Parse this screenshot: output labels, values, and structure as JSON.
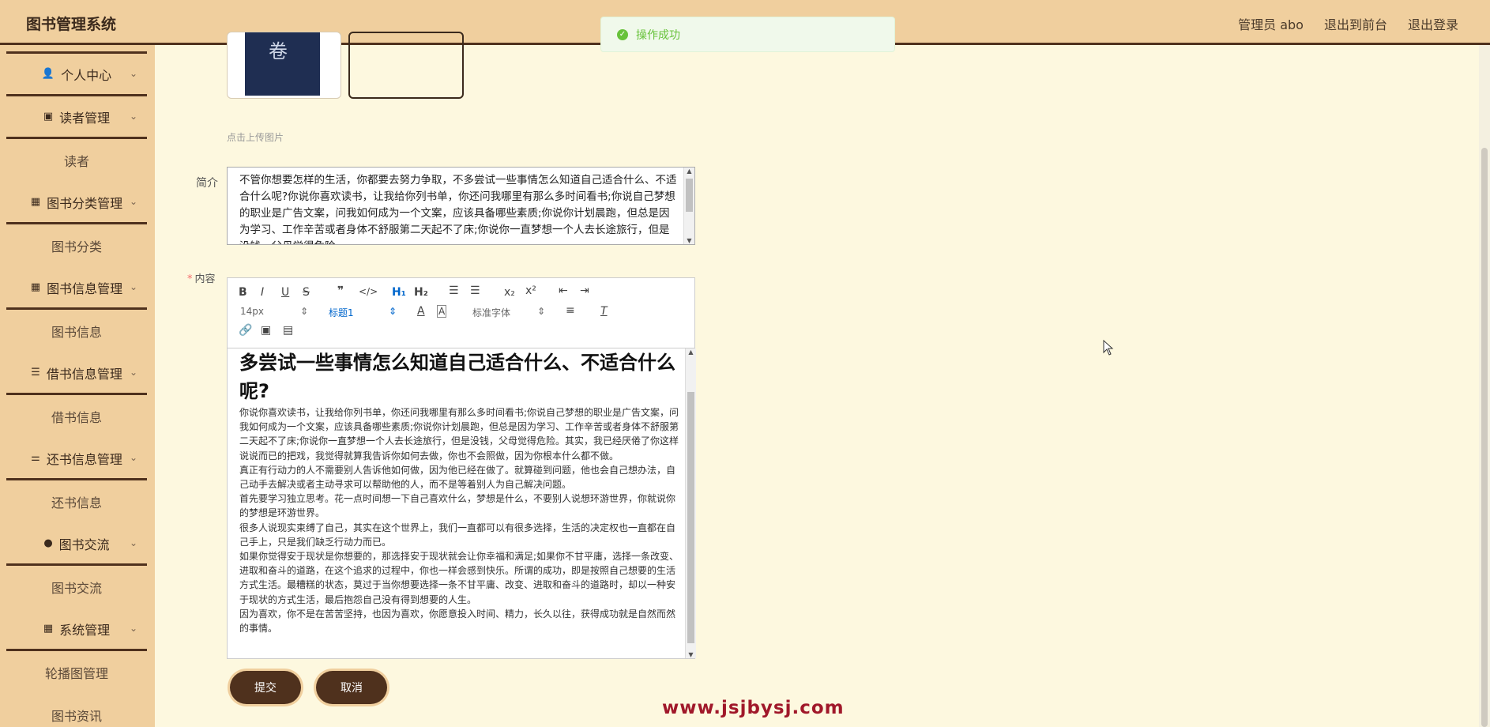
{
  "header": {
    "brand": "图书管理系统",
    "admin": "管理员 abo",
    "to_front": "退出到前台",
    "logout": "退出登录"
  },
  "toast": {
    "message": "操作成功"
  },
  "sidebar": {
    "items": [
      {
        "label": "个人中心",
        "icon": "user-icon",
        "type": "group"
      },
      {
        "label": "读者管理",
        "icon": "clipboard-icon",
        "type": "group"
      },
      {
        "label": "读者",
        "type": "sub"
      },
      {
        "label": "图书分类管理",
        "icon": "grid-icon",
        "type": "group"
      },
      {
        "label": "图书分类",
        "type": "sub"
      },
      {
        "label": "图书信息管理",
        "icon": "grid-icon",
        "type": "group"
      },
      {
        "label": "图书信息",
        "type": "sub"
      },
      {
        "label": "借书信息管理",
        "icon": "list-icon",
        "type": "group"
      },
      {
        "label": "借书信息",
        "type": "sub"
      },
      {
        "label": "还书信息管理",
        "icon": "sliders-icon",
        "type": "group"
      },
      {
        "label": "还书信息",
        "type": "sub"
      },
      {
        "label": "图书交流",
        "icon": "bulb-icon",
        "type": "group"
      },
      {
        "label": "图书交流",
        "type": "sub"
      },
      {
        "label": "系统管理",
        "icon": "grid-icon",
        "type": "group"
      },
      {
        "label": "轮播图管理",
        "type": "sub"
      },
      {
        "label": "图书资讯",
        "type": "sub"
      }
    ]
  },
  "form": {
    "upload_tip": "点击上传图片",
    "intro_label": "简介",
    "intro_text": "不管你想要怎样的生活，你都要去努力争取，不多尝试一些事情怎么知道自己适合什么、不适合什么呢?你说你喜欢读书，让我给你列书单，你还问我哪里有那么多时间看书;你说自己梦想的职业是广告文案，问我如何成为一个文案，应该具备哪些素质;你说你计划晨跑，但总是因为学习、工作辛苦或者身体不舒服第二天起不了床;你说你一直梦想一个人去长途旅行，但是没钱，父母觉得危险。",
    "content_label": "内容",
    "content_heading": "多尝试一些事情怎么知道自己适合什么、不适合什么呢?",
    "content_paragraphs": [
      "你说你喜欢读书，让我给你列书单，你还问我哪里有那么多时间看书;你说自己梦想的职业是广告文案，问我如何成为一个文案，应该具备哪些素质;你说你计划晨跑，但总是因为学习、工作辛苦或者身体不舒服第二天起不了床;你说你一直梦想一个人去长途旅行，但是没钱，父母觉得危险。其实，我已经厌倦了你这样说说而已的把戏，我觉得就算我告诉你如何去做，你也不会照做，因为你根本什么都不做。",
      "真正有行动力的人不需要别人告诉他如何做，因为他已经在做了。就算碰到问题，他也会自己想办法，自己动手去解决或者主动寻求可以帮助他的人，而不是等着别人为自己解决问题。",
      "首先要学习独立思考。花一点时间想一下自己喜欢什么，梦想是什么，不要别人说想环游世界，你就说你的梦想是环游世界。",
      "很多人说现实束缚了自己，其实在这个世界上，我们一直都可以有很多选择，生活的决定权也一直都在自己手上，只是我们缺乏行动力而已。",
      "如果你觉得安于现状是你想要的，那选择安于现状就会让你幸福和满足;如果你不甘平庸，选择一条改变、进取和奋斗的道路，在这个追求的过程中，你也一样会感到快乐。所谓的成功，即是按照自己想要的生活方式生活。最糟糕的状态，莫过于当你想要选择一条不甘平庸、改变、进取和奋斗的道路时，却以一种安于现状的方式生活，最后抱怨自己没有得到想要的人生。",
      "因为喜欢，你不是在苦苦坚持，也因为喜欢，你愿意投入时间、精力，长久以往，获得成功就是自然而然的事情。"
    ],
    "toolbar": {
      "font_size": "14px",
      "heading": "标题1",
      "font_family": "标准字体"
    },
    "submit": "提交",
    "cancel": "取消"
  },
  "watermark": "www.jsjbysj.com",
  "colors": {
    "header_bg": "#f0cf9e",
    "accent_dark": "#4f311d",
    "page_bg": "#fdf8df",
    "success": "#67c23a",
    "watermark": "#a0182a"
  }
}
